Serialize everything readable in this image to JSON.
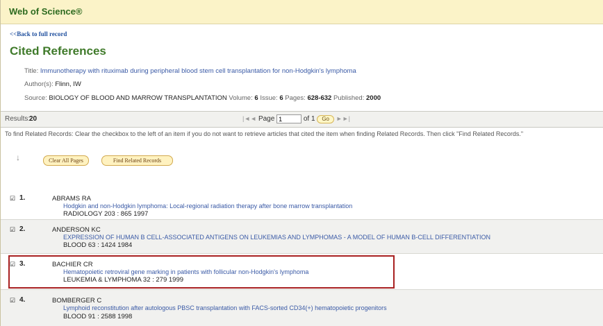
{
  "header": {
    "brand": "Web of Science®"
  },
  "nav": {
    "back": "<<Back to full record"
  },
  "page": {
    "heading": "Cited References"
  },
  "record": {
    "title_label": "Title:",
    "title": "Immunotherapy with rituximab during peripheral blood stem cell transplantation for non-Hodgkin's lymphoma",
    "authors_label": "Author(s):",
    "authors": "Flinn, IW",
    "source_label": "Source:",
    "source": "BIOLOGY OF BLOOD AND MARROW TRANSPLANTATION",
    "volume_label": "Volume:",
    "volume": "6",
    "issue_label": "Issue:",
    "issue": "6",
    "pages_label": "Pages:",
    "pages": "628-632",
    "published_label": "Published:",
    "published": "2000"
  },
  "results": {
    "label": "Results:",
    "count": "20",
    "first": "|◄◄",
    "page_label": "Page",
    "page_value": "1",
    "of_label": "of 1",
    "go": "Go",
    "next": "►►|"
  },
  "instructions": "To find Related Records: Clear the checkbox to the left of an item if you do not want to retrieve articles that cited the item when finding Related Records. Then click \"Find Related Records.\"",
  "actions": {
    "clear_all": "Clear All Pages",
    "find_related": "Find Related Records"
  },
  "references": [
    {
      "num": "1.",
      "author": "ABRAMS RA",
      "title": "Hodgkin and non-Hodgkin lymphoma: Local-regional radiation therapy after bone marrow transplantation",
      "source": "RADIOLOGY 203 : 865 1997"
    },
    {
      "num": "2.",
      "author": "ANDERSON KC",
      "title": "EXPRESSION OF HUMAN B CELL-ASSOCIATED ANTIGENS ON LEUKEMIAS AND LYMPHOMAS - A MODEL OF HUMAN B-CELL DIFFERENTIATION",
      "source": "BLOOD 63 : 1424 1984"
    },
    {
      "num": "3.",
      "author": "BACHIER CR",
      "title": "Hematopoietic retroviral gene marking in patients with follicular non-Hodgkin's lymphoma",
      "source": "LEUKEMIA & LYMPHOMA 32 : 279 1999"
    },
    {
      "num": "4.",
      "author": "BOMBERGER C",
      "title": "Lymphoid reconstitution after autologous PBSC transplantation with FACS-sorted CD34(+) hematopoietic progenitors",
      "source": "BLOOD 91 : 2588 1998"
    }
  ],
  "colors": {
    "brand_green": "#2d6a1f",
    "link_blue": "#3a5aa6",
    "highlight_red": "#a82020",
    "header_bg": "#fbf3c8"
  }
}
